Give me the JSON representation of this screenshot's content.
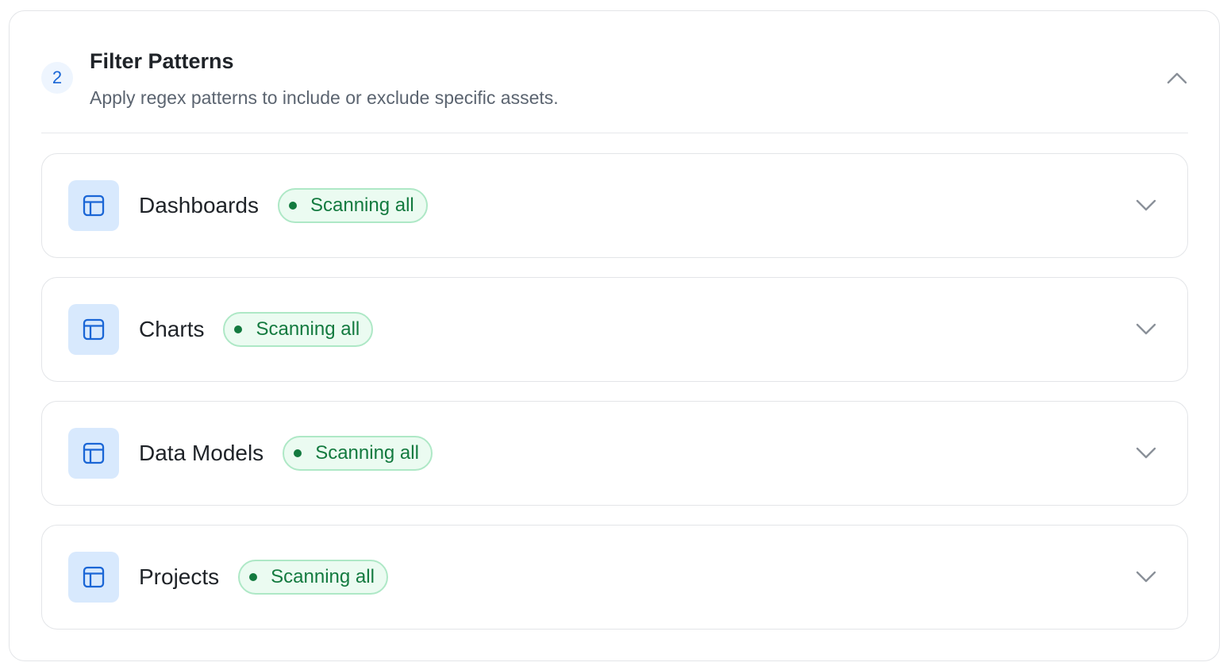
{
  "section": {
    "step_number": "2",
    "title": "Filter Patterns",
    "description": "Apply regex patterns to include or exclude specific assets.",
    "toggle_icon": "chevron-up-icon"
  },
  "asset_types": [
    {
      "label": "Dashboards",
      "status": "Scanning all",
      "icon": "table-layout-icon"
    },
    {
      "label": "Charts",
      "status": "Scanning all",
      "icon": "table-layout-icon"
    },
    {
      "label": "Data Models",
      "status": "Scanning all",
      "icon": "table-layout-icon"
    },
    {
      "label": "Projects",
      "status": "Scanning all",
      "icon": "table-layout-icon"
    }
  ],
  "colors": {
    "accent_blue": "#1a66d6",
    "icon_bg": "#d8e9fd",
    "status_green": "#137a3f",
    "status_bg": "#ebfbf1",
    "status_border": "#aee8c6"
  }
}
